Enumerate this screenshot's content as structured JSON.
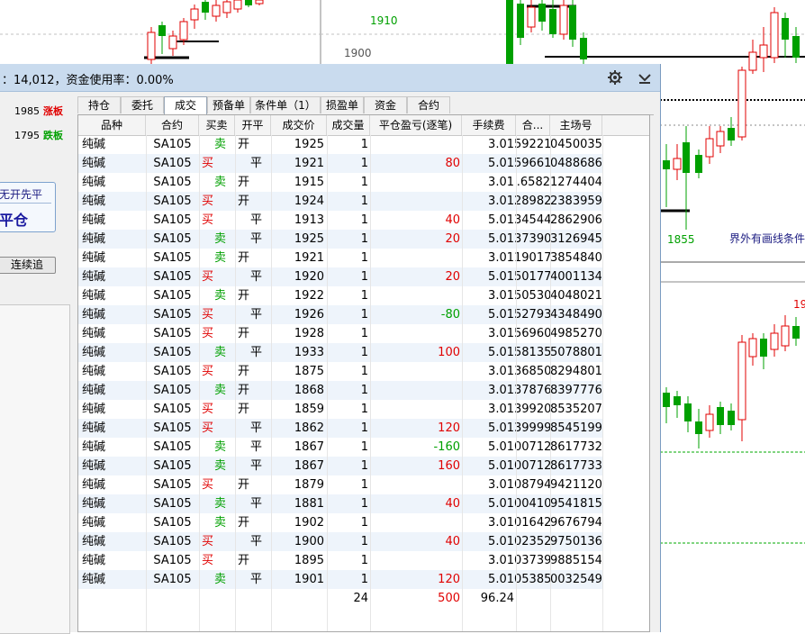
{
  "chart_labels": {
    "price_1910": "1910",
    "price_1900": "1900",
    "price_1855": "1855",
    "price_19": "19",
    "overlay_text": "界外有画线条件"
  },
  "status_bar": {
    "text": "：14,012，资金使用率：0.00%"
  },
  "left_panel": {
    "limit_up_price": "1985",
    "limit_up_label": "涨板",
    "limit_down_price": "1795",
    "limit_down_label": "跌板",
    "mode_top": "无开先平",
    "mode_main": "平仓",
    "chase_button": "连续追"
  },
  "tabs": [
    {
      "label": "持仓"
    },
    {
      "label": "委托"
    },
    {
      "label": "成交"
    },
    {
      "label": "预备单"
    },
    {
      "label": "条件单（1）"
    },
    {
      "label": "损盈单"
    },
    {
      "label": "资金"
    },
    {
      "label": "合约"
    }
  ],
  "columns": [
    "品种",
    "合约",
    "买卖",
    "开平",
    "成交价",
    "成交量",
    "平仓盈亏(逐笔)",
    "手续费",
    "合...",
    "主场号"
  ],
  "rows": [
    {
      "product": "纯碱",
      "contract": "SA105",
      "side": "卖",
      "oc": "开",
      "price": "1925",
      "qty": "1",
      "pnl": "",
      "fee": "3.01",
      "x": "59221",
      "id": "0450035"
    },
    {
      "product": "纯碱",
      "contract": "SA105",
      "side": "买",
      "oc": "平",
      "price": "1921",
      "qty": "1",
      "pnl": "80",
      "fee": "5.01",
      "x": "59661",
      "id": "0488686"
    },
    {
      "product": "纯碱",
      "contract": "SA105",
      "side": "卖",
      "oc": "开",
      "price": "1915",
      "qty": "1",
      "pnl": "",
      "fee": "3.01",
      "x": ".6582",
      "id": "1274404"
    },
    {
      "product": "纯碱",
      "contract": "SA105",
      "side": "买",
      "oc": "开",
      "price": "1924",
      "qty": "1",
      "pnl": "",
      "fee": "3.01",
      "x": "28982",
      "id": "2383959"
    },
    {
      "product": "纯碱",
      "contract": "SA105",
      "side": "买",
      "oc": "平",
      "price": "1913",
      "qty": "1",
      "pnl": "40",
      "fee": "5.01",
      "x": "34544",
      "id": "2862906"
    },
    {
      "product": "纯碱",
      "contract": "SA105",
      "side": "卖",
      "oc": "平",
      "price": "1925",
      "qty": "1",
      "pnl": "20",
      "fee": "5.01",
      "x": "37390",
      "id": "3126945"
    },
    {
      "product": "纯碱",
      "contract": "SA105",
      "side": "卖",
      "oc": "开",
      "price": "1921",
      "qty": "1",
      "pnl": "",
      "fee": "3.01",
      "x": "19017",
      "id": "3854840"
    },
    {
      "product": "纯碱",
      "contract": "SA105",
      "side": "买",
      "oc": "平",
      "price": "1920",
      "qty": "1",
      "pnl": "20",
      "fee": "5.01",
      "x": "50177",
      "id": "4001134"
    },
    {
      "product": "纯碱",
      "contract": "SA105",
      "side": "卖",
      "oc": "开",
      "price": "1922",
      "qty": "1",
      "pnl": "",
      "fee": "3.01",
      "x": "50530",
      "id": "4048021"
    },
    {
      "product": "纯碱",
      "contract": "SA105",
      "side": "买",
      "oc": "平",
      "price": "1926",
      "qty": "1",
      "pnl": "-80",
      "fee": "5.01",
      "x": "52793",
      "id": "4348490"
    },
    {
      "product": "纯碱",
      "contract": "SA105",
      "side": "买",
      "oc": "开",
      "price": "1928",
      "qty": "1",
      "pnl": "",
      "fee": "3.01",
      "x": "56960",
      "id": "4985270"
    },
    {
      "product": "纯碱",
      "contract": "SA105",
      "side": "卖",
      "oc": "平",
      "price": "1933",
      "qty": "1",
      "pnl": "100",
      "fee": "5.01",
      "x": "58135",
      "id": "5078801"
    },
    {
      "product": "纯碱",
      "contract": "SA105",
      "side": "买",
      "oc": "开",
      "price": "1875",
      "qty": "1",
      "pnl": "",
      "fee": "3.01",
      "x": "36850",
      "id": "8294801"
    },
    {
      "product": "纯碱",
      "contract": "SA105",
      "side": "卖",
      "oc": "开",
      "price": "1868",
      "qty": "1",
      "pnl": "",
      "fee": "3.01",
      "x": "37876",
      "id": "8397776"
    },
    {
      "product": "纯碱",
      "contract": "SA105",
      "side": "买",
      "oc": "开",
      "price": "1859",
      "qty": "1",
      "pnl": "",
      "fee": "3.01",
      "x": "39920",
      "id": "8535207"
    },
    {
      "product": "纯碱",
      "contract": "SA105",
      "side": "买",
      "oc": "平",
      "price": "1862",
      "qty": "1",
      "pnl": "120",
      "fee": "5.01",
      "x": "39999",
      "id": "8545199"
    },
    {
      "product": "纯碱",
      "contract": "SA105",
      "side": "卖",
      "oc": "平",
      "price": "1867",
      "qty": "1",
      "pnl": "-160",
      "fee": "5.01",
      "x": "00712",
      "id": "8617732"
    },
    {
      "product": "纯碱",
      "contract": "SA105",
      "side": "卖",
      "oc": "平",
      "price": "1867",
      "qty": "1",
      "pnl": "160",
      "fee": "5.01",
      "x": "00712",
      "id": "8617733"
    },
    {
      "product": "纯碱",
      "contract": "SA105",
      "side": "买",
      "oc": "开",
      "price": "1879",
      "qty": "1",
      "pnl": "",
      "fee": "3.01",
      "x": "08794",
      "id": "9421120"
    },
    {
      "product": "纯碱",
      "contract": "SA105",
      "side": "卖",
      "oc": "平",
      "price": "1881",
      "qty": "1",
      "pnl": "40",
      "fee": "5.01",
      "x": "00410",
      "id": "9541815"
    },
    {
      "product": "纯碱",
      "contract": "SA105",
      "side": "卖",
      "oc": "开",
      "price": "1902",
      "qty": "1",
      "pnl": "",
      "fee": "3.01",
      "x": "01642",
      "id": "9676794"
    },
    {
      "product": "纯碱",
      "contract": "SA105",
      "side": "买",
      "oc": "平",
      "price": "1900",
      "qty": "1",
      "pnl": "40",
      "fee": "5.01",
      "x": "02352",
      "id": "9750136"
    },
    {
      "product": "纯碱",
      "contract": "SA105",
      "side": "买",
      "oc": "开",
      "price": "1895",
      "qty": "1",
      "pnl": "",
      "fee": "3.01",
      "x": "03739",
      "id": "9885154"
    },
    {
      "product": "纯碱",
      "contract": "SA105",
      "side": "卖",
      "oc": "平",
      "price": "1901",
      "qty": "1",
      "pnl": "120",
      "fee": "5.01",
      "x": "05385",
      "id": "0032549"
    }
  ],
  "totals": {
    "qty": "24",
    "pnl": "500",
    "fee": "96.24"
  },
  "colors": {
    "buy": "#e00000",
    "sell": "#00a000",
    "up_candle": "#e00000",
    "down_candle": "#00a000",
    "titlebar": "#c9dbee",
    "row_alt": "#eef4fb"
  },
  "icons": {
    "settings": "gear-icon",
    "collapse": "chevron-down-icon"
  }
}
